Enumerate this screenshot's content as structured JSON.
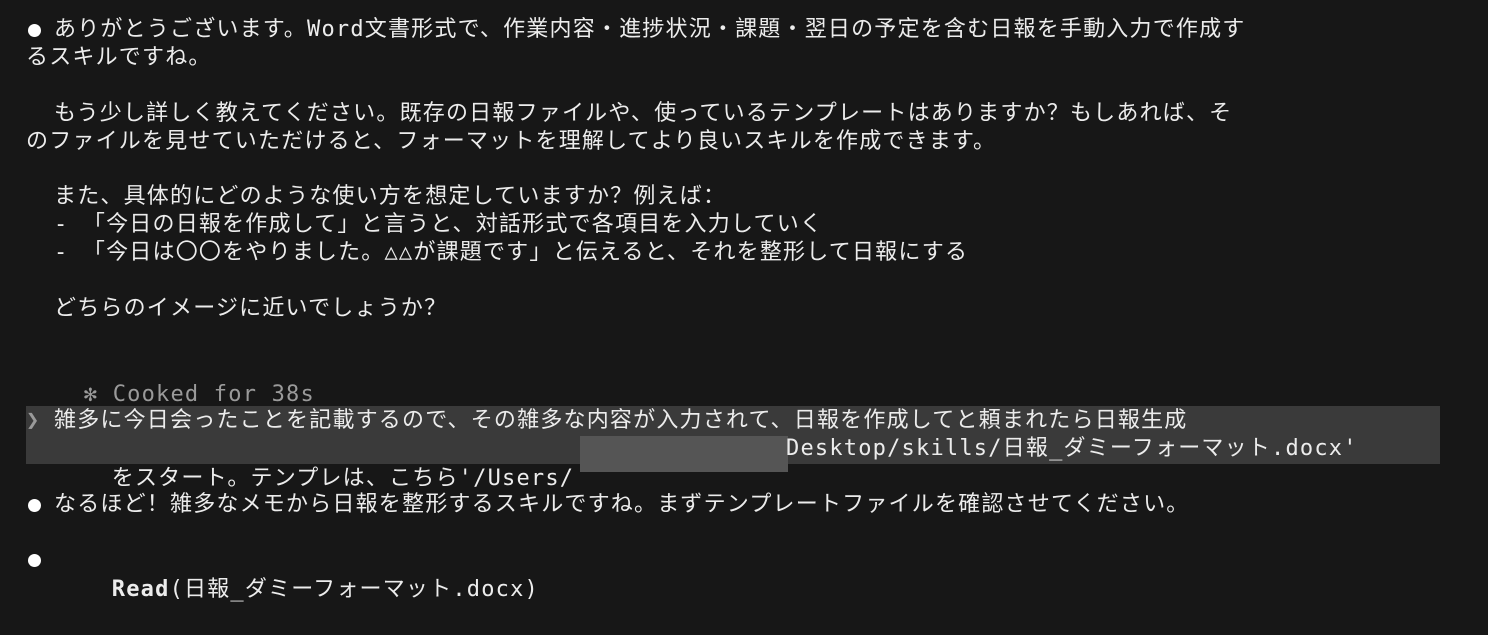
{
  "assistant_msg_1": {
    "line1": "ありがとうございます。Word文書形式で、作業内容・進捗状況・課題・翌日の予定を含む日報を手動入力で作成す",
    "line2": "るスキルですね。",
    "para2_line1": "もう少し詳しく教えてください。既存の日報ファイルや、使っているテンプレートはありますか？もしあれば、そ",
    "para2_line2": "のファイルを見せていただけると、フォーマットを理解してより良いスキルを作成できます。",
    "para3_line1": "また、具体的にどのような使い方を想定していますか？例えば：",
    "option1": "- 「今日の日報を作成して」と言うと、対話形式で各項目を入力していく",
    "option2": "- 「今日は〇〇をやりました。△△が課題です」と伝えると、それを整形して日報にする",
    "question": "どちらのイメージに近いでしょうか？"
  },
  "status": {
    "star": "✻",
    "text": "Cooked for 38s"
  },
  "user_msg": {
    "prompt_glyph": "❯",
    "line1": "雑多に今日会ったことを記載するので、その雑多な内容が入力されて、日報を作成してと頼まれたら日報生成",
    "line2_part1": "をスタート。テンプレは、こちら'/Users/",
    "line2_part2": "Desktop/skills/日報_ダミーフォーマット.docx'"
  },
  "assistant_msg_2": {
    "text": "なるほど！雑多なメモから日報を整形するスキルですね。まずテンプレートファイルを確認させてください。"
  },
  "tool_call": {
    "name": "Read",
    "arg": "(日報_ダミーフォーマット.docx)"
  }
}
